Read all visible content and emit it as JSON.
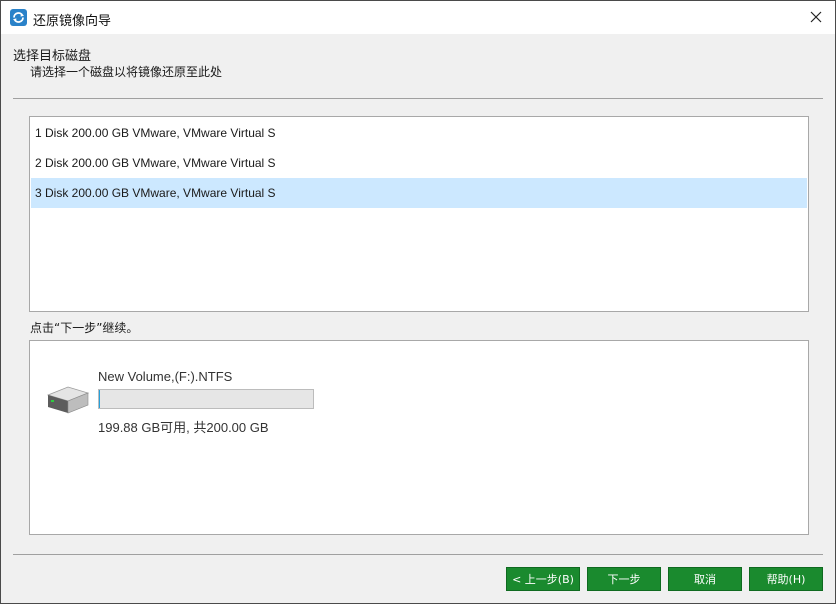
{
  "window": {
    "title": "还原镜像向导"
  },
  "header": {
    "heading": "选择目标磁盘",
    "subheading": "请选择一个磁盘以将镜像还原至此处"
  },
  "disks": [
    {
      "label": "1 Disk 200.00 GB VMware,  VMware Virtual S",
      "selected": false
    },
    {
      "label": "2 Disk 200.00 GB VMware,  VMware Virtual S",
      "selected": false
    },
    {
      "label": "3 Disk 200.00 GB VMware,  VMware Virtual S",
      "selected": true
    }
  ],
  "hint": "点击“下一步”继续。",
  "volume": {
    "name": "New Volume,(F:).NTFS",
    "used_fraction": 0.0006,
    "size_text": "199.88 GB可用, 共200.00 GB"
  },
  "buttons": {
    "back": "< 上一步(B)",
    "next": "下一步",
    "cancel": "取消",
    "help": "帮助(H)"
  },
  "colors": {
    "button_green": "#1a8a2e",
    "selection": "#cce8ff",
    "usage_fill": "#26a0da"
  },
  "icons": {
    "app": "restore-wizard-icon",
    "close": "close-icon",
    "drive": "hard-drive-icon"
  }
}
